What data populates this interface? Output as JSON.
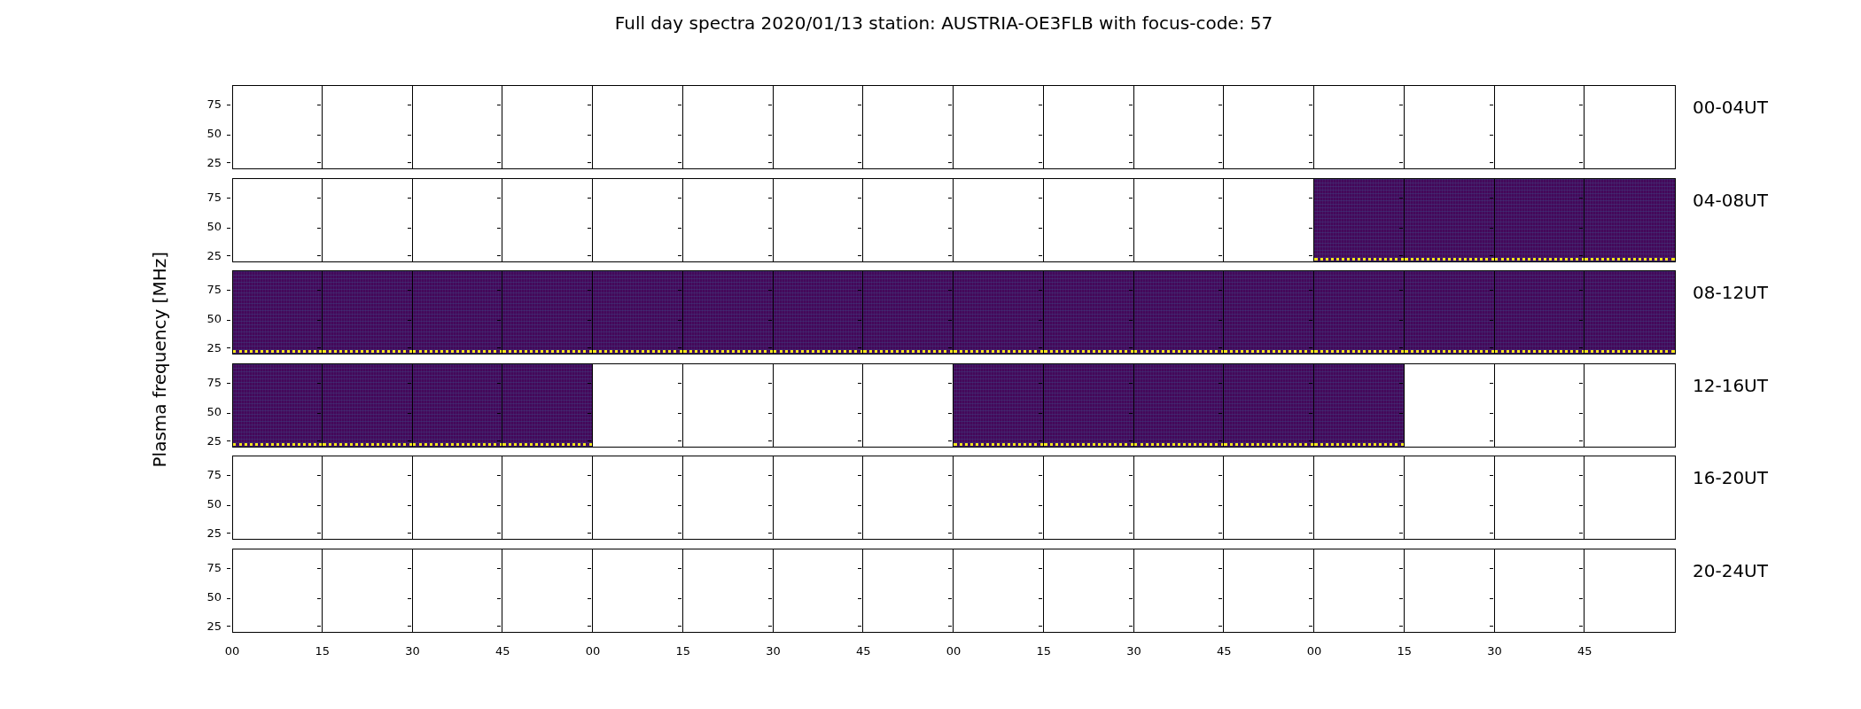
{
  "title": "Full day spectra 2020/01/13 station: AUSTRIA-OE3FLB with focus-code: 57",
  "ylabel": "Plasma frequency [MHz]",
  "xticks": [
    "00",
    "15",
    "30",
    "45",
    "00",
    "15",
    "30",
    "45",
    "00",
    "15",
    "30",
    "45",
    "00",
    "15",
    "30",
    "45"
  ],
  "rows": [
    {
      "label": "00-04UT",
      "yticks": [
        "75",
        "50",
        "25"
      ],
      "panels": [
        {
          "has_data": false
        },
        {
          "has_data": false
        },
        {
          "has_data": false
        },
        {
          "has_data": false
        },
        {
          "has_data": false
        },
        {
          "has_data": false
        },
        {
          "has_data": false
        },
        {
          "has_data": false
        },
        {
          "has_data": false
        },
        {
          "has_data": false
        },
        {
          "has_data": false
        },
        {
          "has_data": false
        },
        {
          "has_data": false
        },
        {
          "has_data": false
        },
        {
          "has_data": false
        },
        {
          "has_data": false
        }
      ]
    },
    {
      "label": "04-08UT",
      "yticks": [
        "75",
        "50",
        "25"
      ],
      "panels": [
        {
          "has_data": false
        },
        {
          "has_data": false
        },
        {
          "has_data": false
        },
        {
          "has_data": false
        },
        {
          "has_data": false
        },
        {
          "has_data": false
        },
        {
          "has_data": false
        },
        {
          "has_data": false
        },
        {
          "has_data": false
        },
        {
          "has_data": false
        },
        {
          "has_data": false
        },
        {
          "has_data": false
        },
        {
          "has_data": true
        },
        {
          "has_data": true
        },
        {
          "has_data": true
        },
        {
          "has_data": true
        }
      ]
    },
    {
      "label": "08-12UT",
      "yticks": [
        "75",
        "50",
        "25"
      ],
      "panels": [
        {
          "has_data": true
        },
        {
          "has_data": true
        },
        {
          "has_data": true
        },
        {
          "has_data": true
        },
        {
          "has_data": true
        },
        {
          "has_data": true
        },
        {
          "has_data": true
        },
        {
          "has_data": true
        },
        {
          "has_data": true
        },
        {
          "has_data": true
        },
        {
          "has_data": true
        },
        {
          "has_data": true
        },
        {
          "has_data": true
        },
        {
          "has_data": true
        },
        {
          "has_data": true
        },
        {
          "has_data": true
        }
      ]
    },
    {
      "label": "12-16UT",
      "yticks": [
        "75",
        "50",
        "25"
      ],
      "panels": [
        {
          "has_data": true
        },
        {
          "has_data": true
        },
        {
          "has_data": true
        },
        {
          "has_data": true
        },
        {
          "has_data": false
        },
        {
          "has_data": false
        },
        {
          "has_data": false
        },
        {
          "has_data": false
        },
        {
          "has_data": true
        },
        {
          "has_data": true
        },
        {
          "has_data": true
        },
        {
          "has_data": true
        },
        {
          "has_data": true
        },
        {
          "has_data": false
        },
        {
          "has_data": false
        },
        {
          "has_data": false
        }
      ]
    },
    {
      "label": "16-20UT",
      "yticks": [
        "75",
        "50",
        "25"
      ],
      "panels": [
        {
          "has_data": false
        },
        {
          "has_data": false
        },
        {
          "has_data": false
        },
        {
          "has_data": false
        },
        {
          "has_data": false
        },
        {
          "has_data": false
        },
        {
          "has_data": false
        },
        {
          "has_data": false
        },
        {
          "has_data": false
        },
        {
          "has_data": false
        },
        {
          "has_data": false
        },
        {
          "has_data": false
        },
        {
          "has_data": false
        },
        {
          "has_data": false
        },
        {
          "has_data": false
        },
        {
          "has_data": false
        }
      ]
    },
    {
      "label": "20-24UT",
      "yticks": [
        "75",
        "50",
        "25"
      ],
      "panels": [
        {
          "has_data": false
        },
        {
          "has_data": false
        },
        {
          "has_data": false
        },
        {
          "has_data": false
        },
        {
          "has_data": false
        },
        {
          "has_data": false
        },
        {
          "has_data": false
        },
        {
          "has_data": false
        },
        {
          "has_data": false
        },
        {
          "has_data": false
        },
        {
          "has_data": false
        },
        {
          "has_data": false
        },
        {
          "has_data": false
        },
        {
          "has_data": false
        },
        {
          "has_data": false
        },
        {
          "has_data": false
        }
      ]
    }
  ]
}
